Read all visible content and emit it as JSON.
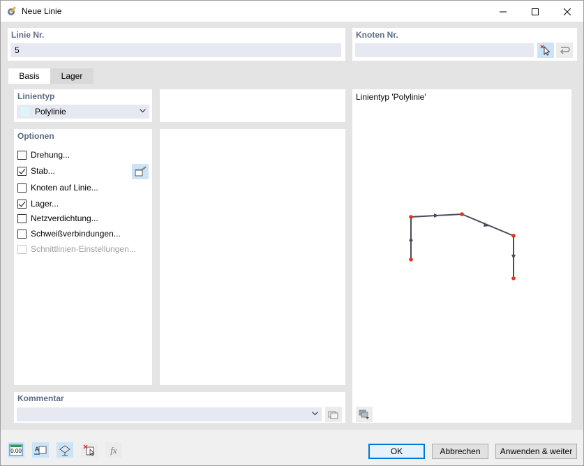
{
  "window": {
    "title": "Neue Linie"
  },
  "line_no": {
    "label": "Linie Nr.",
    "value": "5"
  },
  "node_no": {
    "label": "Knoten Nr.",
    "value": ""
  },
  "tabs": [
    {
      "label": "Basis"
    },
    {
      "label": "Lager"
    }
  ],
  "linetype": {
    "label": "Linientyp",
    "selected": "Polylinie"
  },
  "options": {
    "label": "Optionen",
    "items": [
      {
        "label": "Drehung...",
        "checked": false,
        "disabled": false
      },
      {
        "label": "Stab...",
        "checked": true,
        "disabled": false
      },
      {
        "label": "Knoten auf Linie...",
        "checked": false,
        "disabled": false
      },
      {
        "label": "Lager...",
        "checked": true,
        "disabled": false
      },
      {
        "label": "Netzverdichtung...",
        "checked": false,
        "disabled": false
      },
      {
        "label": "Schweißverbindungen...",
        "checked": false,
        "disabled": false
      },
      {
        "label": "Schnittlinien-Einstellungen...",
        "checked": false,
        "disabled": true
      }
    ]
  },
  "preview": {
    "title": "Linientyp 'Polylinie'"
  },
  "comment": {
    "label": "Kommentar",
    "value": ""
  },
  "buttons": {
    "ok": "OK",
    "cancel": "Abbrechen",
    "apply": "Anwenden & weiter"
  },
  "icons": {
    "app": "line-edit-icon",
    "footer": [
      "units-icon",
      "display-icon",
      "view-icon",
      "select-delete-icon",
      "formula-icon"
    ]
  },
  "colors": {
    "accent": "#0078d7",
    "group_label": "#5c6c85",
    "node": "#d9381e",
    "line": "#4a4a5a"
  }
}
